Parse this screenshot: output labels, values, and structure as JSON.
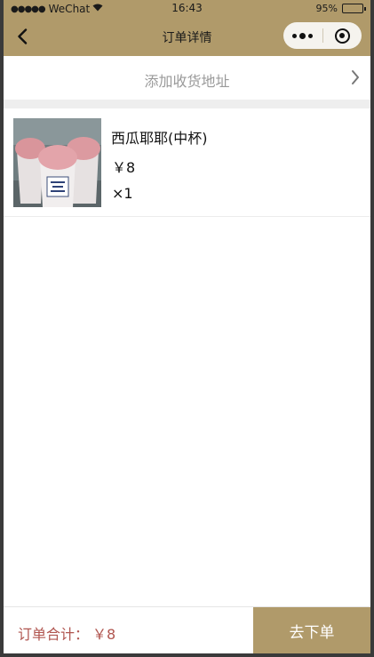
{
  "status_bar": {
    "signal": "●●●●●",
    "carrier": "WeChat",
    "time": "16:43",
    "battery": "95%",
    "battery_level": 0.95
  },
  "nav": {
    "title": "订单详情"
  },
  "address": {
    "label": "添加收货地址"
  },
  "product": {
    "name": "西瓜耶耶(中杯)",
    "price": "￥8",
    "quantity": "×1"
  },
  "footer": {
    "total_label": "订单合计：",
    "total_value": "￥8",
    "submit_label": "去下单"
  },
  "colors": {
    "accent": "#b09a6a",
    "total_text": "#b0554f",
    "placeholder_text": "#9a9a9a"
  }
}
